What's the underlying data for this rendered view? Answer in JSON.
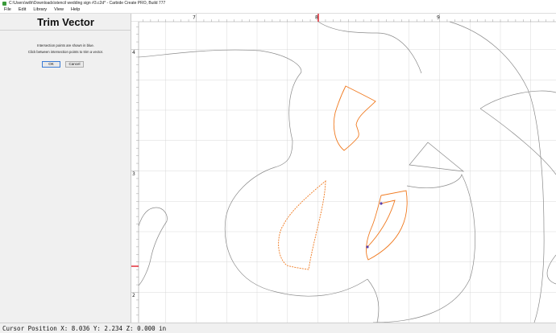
{
  "window": {
    "title": "C:\\Users\\willr\\Downloads\\stencil wedding sign #3.c2d* - Carbide Create PRO, Build 777"
  },
  "menu": [
    {
      "label": "File"
    },
    {
      "label": "Edit"
    },
    {
      "label": "Library"
    },
    {
      "label": "View"
    },
    {
      "label": "Help"
    }
  ],
  "panel": {
    "title": "Trim Vector",
    "message_line1": "Intersection points are shown in blue.",
    "message_line2": "Click between intersection points to trim a vector.",
    "ok_label": "OK",
    "cancel_label": "Cancel"
  },
  "rulers": {
    "top_labels": [
      "7",
      "8",
      "9"
    ],
    "left_labels": [
      "4",
      "3",
      "2"
    ]
  },
  "colors": {
    "outline": "#8a8a8a",
    "selected_vector": "#f07a20",
    "intersection_point": "#5a3fa8",
    "cursor_marker": "#e0202a",
    "grid": "#d9d9d9"
  },
  "status": {
    "cursor": "Cursor Position X: 8.036 Y: 2.234 Z: 0.000 in"
  }
}
